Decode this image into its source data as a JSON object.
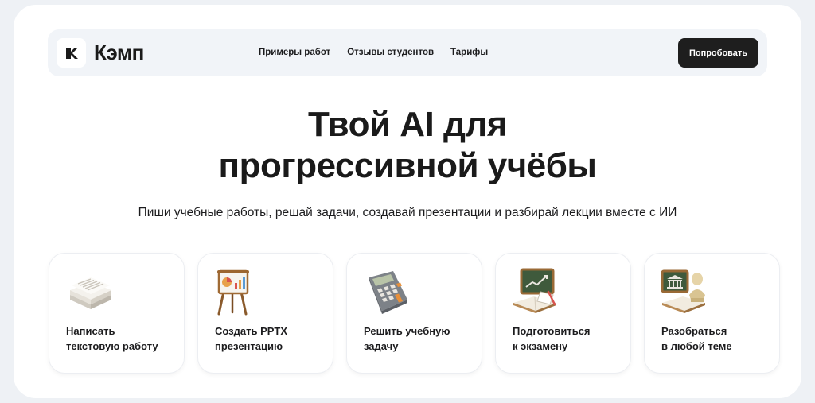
{
  "brand": {
    "name": "Кэмп"
  },
  "nav": {
    "links": [
      "Примеры работ",
      "Отзывы студентов",
      "Тарифы"
    ],
    "cta_label": "Попробовать"
  },
  "hero": {
    "title_line1": "Твой AI для",
    "title_line2": "прогрессивной учёбы",
    "subtitle": "Пиши учебные работы, решай задачи, создавай презентации и разбирай лекции вместе с ИИ"
  },
  "features": [
    {
      "icon": "paper-stack-icon",
      "line1": "Написать",
      "line2": "текстовую работу"
    },
    {
      "icon": "presentation-easel-icon",
      "line1": "Создать PPTX",
      "line2": "презентацию"
    },
    {
      "icon": "calculator-icon",
      "line1": "Решить учебную",
      "line2": "задачу"
    },
    {
      "icon": "chalkboard-books-icon",
      "line1": "Подготовиться",
      "line2": "к экзамену"
    },
    {
      "icon": "museum-bust-icon",
      "line1": "Разобраться",
      "line2": "в любой теме"
    }
  ],
  "colors": {
    "background": "#eef1f5",
    "card": "#ffffff",
    "navbar": "#f1f4f8",
    "cta": "#1e1e1e",
    "text": "#1c1c1e"
  }
}
